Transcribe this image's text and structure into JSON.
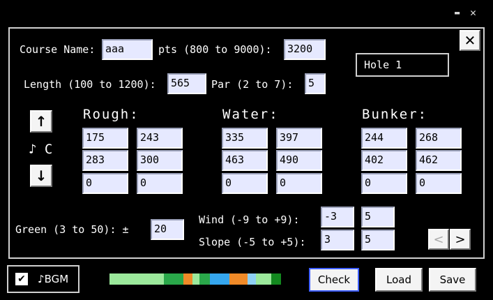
{
  "window": {
    "minimize_glyph": "▬",
    "close_glyph": "✕"
  },
  "dialog_close_glyph": "✕",
  "course_name": {
    "label": "Course Name:",
    "value": "aaa"
  },
  "pts": {
    "label": "pts (800 to 9000):",
    "value": "3200"
  },
  "hole_label": "Hole 1",
  "length": {
    "label": "Length (100 to 1200):",
    "value": "565"
  },
  "par": {
    "label": "Par (2 to 7):",
    "value": "5"
  },
  "scroll": {
    "up": "↑",
    "down": "↓",
    "note": "♪ C"
  },
  "rough": {
    "header": "Rough:",
    "values": [
      "175",
      "243",
      "283",
      "300",
      "0",
      "0"
    ]
  },
  "water": {
    "header": "Water:",
    "values": [
      "335",
      "397",
      "463",
      "490",
      "0",
      "0"
    ]
  },
  "bunker": {
    "header": "Bunker:",
    "values": [
      "244",
      "268",
      "402",
      "462",
      "0",
      "0"
    ]
  },
  "green": {
    "label": "Green (3 to 50): ±",
    "value": "20"
  },
  "wind": {
    "label": "Wind  (-9 to +9):",
    "values": [
      "-3",
      "5"
    ]
  },
  "slope": {
    "label": "Slope (-5 to +5):",
    "values": [
      "3",
      "5"
    ]
  },
  "nav": {
    "prev": "<",
    "next": ">"
  },
  "bgm": {
    "checked": true,
    "check_glyph": "✔",
    "label": "♪BGM"
  },
  "buttons": {
    "check": "Check",
    "load": "Load",
    "save": "Save"
  },
  "colors": {
    "light_green": "#9be89b",
    "green": "#2aa84a",
    "dark_green": "#13891f",
    "orange": "#f08a28",
    "blue": "#35a6ee",
    "light_blue": "#8ed0f4",
    "input_bg": "#e6e9ff"
  },
  "color_bar": [
    "light_green",
    "green",
    "orange",
    "light_green",
    "green",
    "blue",
    "orange",
    "light_blue",
    "light_green",
    "dark_green"
  ]
}
